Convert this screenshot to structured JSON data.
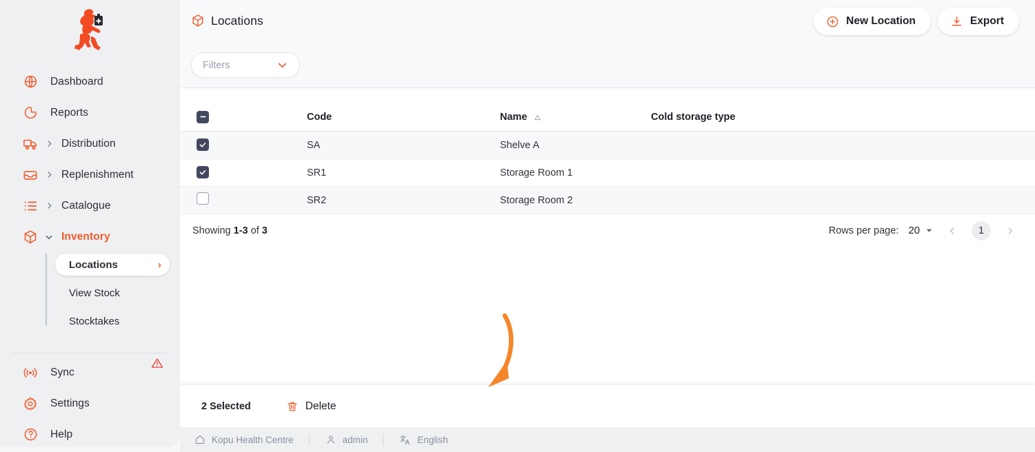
{
  "app": {
    "logo_name": "running-pharmacist-logo",
    "accent_color": "#f05a2a",
    "annotation_color": "#f5862a"
  },
  "sidebar": {
    "items": [
      {
        "label": "Dashboard",
        "icon": "globe-icon",
        "expandable": false,
        "active": false
      },
      {
        "label": "Reports",
        "icon": "pie-chart-icon",
        "expandable": false,
        "active": false
      },
      {
        "label": "Distribution",
        "icon": "truck-icon",
        "expandable": true,
        "active": false
      },
      {
        "label": "Replenishment",
        "icon": "inbox-icon",
        "expandable": true,
        "active": false
      },
      {
        "label": "Catalogue",
        "icon": "list-icon",
        "expandable": true,
        "active": false
      },
      {
        "label": "Inventory",
        "icon": "box-icon",
        "expandable": true,
        "active": true
      }
    ],
    "sub_items": [
      {
        "label": "Locations",
        "active": true,
        "arrow": "›"
      },
      {
        "label": "View Stock",
        "active": false,
        "arrow": ""
      },
      {
        "label": "Stocktakes",
        "active": false,
        "arrow": ""
      }
    ],
    "lower_items": [
      {
        "label": "Sync",
        "icon": "broadcast-icon",
        "warning": true
      },
      {
        "label": "Settings",
        "icon": "gear-icon",
        "warning": false
      },
      {
        "label": "Help",
        "icon": "question-circle-icon",
        "warning": false
      }
    ]
  },
  "header": {
    "title": "Locations",
    "title_icon": "box-icon",
    "new_location_label": "New Location",
    "new_location_icon": "plus-circle-icon",
    "export_label": "Export",
    "export_icon": "download-icon"
  },
  "filters": {
    "label": "Filters",
    "chevron_icon": "chevron-down-icon"
  },
  "table": {
    "columns": [
      {
        "key": "check",
        "label": ""
      },
      {
        "key": "code",
        "label": "Code"
      },
      {
        "key": "name",
        "label": "Name",
        "sort": "ascending"
      },
      {
        "key": "cold",
        "label": "Cold storage type"
      }
    ],
    "header_checkbox_state": "indeterminate",
    "rows": [
      {
        "checked": true,
        "code": "SA",
        "name": "Shelve A",
        "cold": ""
      },
      {
        "checked": true,
        "code": "SR1",
        "name": "Storage Room 1",
        "cold": ""
      },
      {
        "checked": false,
        "code": "SR2",
        "name": "Storage Room 2",
        "cold": ""
      }
    ]
  },
  "pagination": {
    "showing_prefix": "Showing",
    "showing_range": "1-3",
    "showing_middle": "of",
    "showing_total": "3",
    "rows_per_page_label": "Rows per page:",
    "rows_per_page_value": "20",
    "prev_icon": "chevron-left-icon",
    "next_icon": "chevron-right-icon",
    "current_page": "1"
  },
  "action_bar": {
    "selected_label": "2 Selected",
    "delete_label": "Delete",
    "delete_icon": "trash-icon"
  },
  "footer": {
    "store": "Kopu Health Centre",
    "store_icon": "home-icon",
    "user": "admin",
    "user_icon": "person-icon",
    "language": "English",
    "language_icon": "translate-icon"
  },
  "annotation": {
    "type": "curved-arrow",
    "points_to": "delete-button"
  }
}
